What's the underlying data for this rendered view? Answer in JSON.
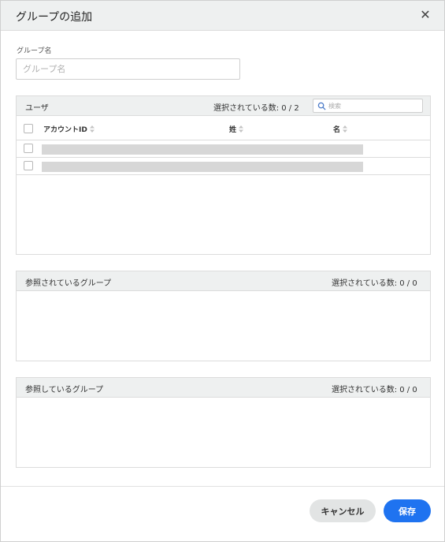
{
  "dialog": {
    "title": "グループの追加",
    "close_label": "✕"
  },
  "group_name": {
    "label": "グループ名",
    "placeholder": "グループ名",
    "value": ""
  },
  "users_panel": {
    "title": "ユーザ",
    "selected_count": "選択されている数: 0 / 2",
    "search_placeholder": "検索",
    "columns": [
      "アカウントID",
      "姓",
      "名"
    ],
    "rows": 2
  },
  "referenced_groups_panel": {
    "title": "参照されているグループ",
    "selected_count": "選択されている数: 0 / 0"
  },
  "referencing_groups_panel": {
    "title": "参照しているグループ",
    "selected_count": "選択されている数: 0 / 0"
  },
  "footer": {
    "cancel_label": "キャンセル",
    "save_label": "保存"
  },
  "colors": {
    "primary": "#1f73f0",
    "header_bg": "#eef0f0"
  }
}
